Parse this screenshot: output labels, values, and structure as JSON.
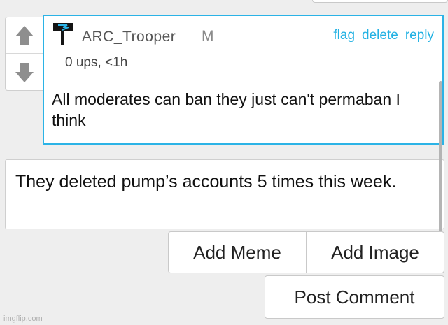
{
  "comment": {
    "username": "ARC_Trooper",
    "badge": "M",
    "actions": {
      "flag": "flag",
      "delete": "delete",
      "reply": "reply"
    },
    "meta": "0 ups, <1h",
    "text": "All moderates can ban they just can't permaban I think",
    "avatar_icon": "flag-logo-icon",
    "accent_color": "#2bb3e6"
  },
  "vote": {
    "up_icon": "arrow-up-icon",
    "down_icon": "arrow-down-icon"
  },
  "reply": {
    "value": "They deleted pump’s accounts 5 times this week."
  },
  "buttons": {
    "add_meme": "Add Meme",
    "add_image": "Add Image",
    "post_comment": "Post Comment"
  },
  "watermark": "imgflip.com"
}
